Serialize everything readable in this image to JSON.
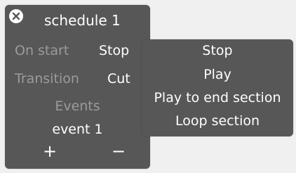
{
  "panel": {
    "title": "schedule 1",
    "close_icon": "close-circle-icon",
    "on_start": {
      "label": "On start",
      "value": "Stop"
    },
    "transition": {
      "label": "Transition",
      "value": "Cut"
    },
    "events_label": "Events",
    "events": [
      "event 1"
    ],
    "add_label": "+",
    "remove_label": "−"
  },
  "dropdown": {
    "options": [
      "Stop",
      "Play",
      "Play to end section",
      "Loop section"
    ]
  },
  "colors": {
    "panel_bg": "#575757",
    "label_gray": "#9b9b9b",
    "text_white": "#ffffff",
    "page_bg": "#f0f0f0"
  }
}
